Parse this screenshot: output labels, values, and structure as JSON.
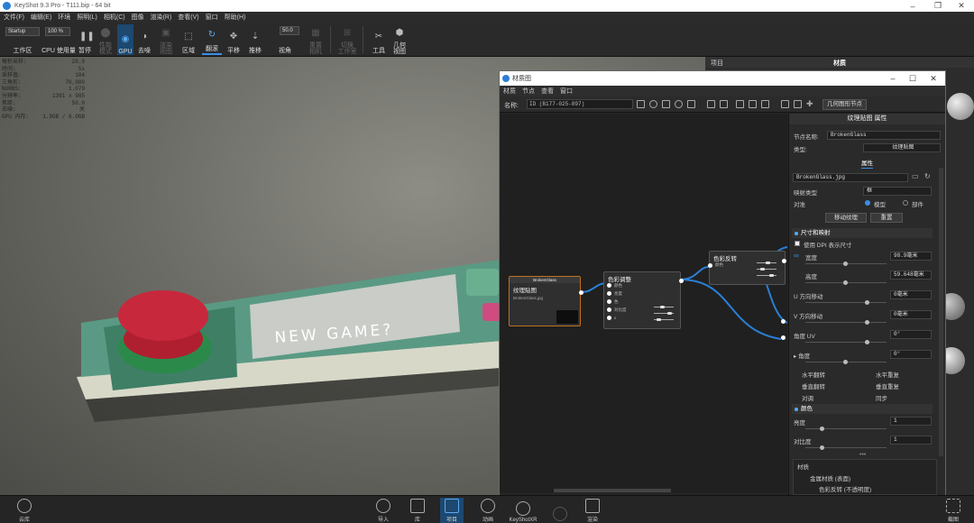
{
  "app": {
    "title": "KeyShot 9.3 Pro  -  T111.bip  -  64 bit"
  },
  "menubar": [
    "文件(F)",
    "编辑(E)",
    "环境",
    "照明(L)",
    "相机(C)",
    "图像",
    "渲染(R)",
    "查看(V)",
    "窗口",
    "帮助(H)"
  ],
  "toolbar": {
    "workspace_value": "Startup",
    "workspace_label": "工作区",
    "cpu_usage_value": "100 %",
    "cpu_usage_label": "CPU 使用量",
    "pause_label": "暂停",
    "perf_mode_label": "性能\n模式",
    "gpu_label": "GPU",
    "denoise_label": "去噪",
    "region_render_label": "渲染\n视图",
    "region_label": "区域",
    "tumble_label": "翻滚",
    "pan_label": "平移",
    "dolly_label": "推移",
    "fov_value": "50.0",
    "fov_label": "视角",
    "reset_camera_label": "重置\n相机",
    "switch_workspace_label": "切换\n工作室",
    "tools_label": "工具",
    "geometry_view_label": "几何\n视图"
  },
  "stats": [
    {
      "k": "每秒采样:",
      "v": "28.9"
    },
    {
      "k": "时间:",
      "v": "5s"
    },
    {
      "k": "采样值:",
      "v": "104"
    },
    {
      "k": "三角形:",
      "v": "70,080"
    },
    {
      "k": "NURBS:",
      "v": "1.079"
    },
    {
      "k": "分辨率:",
      "v": "1391 x 985"
    },
    {
      "k": "焦距:",
      "v": "50.0"
    },
    {
      "k": "去噪:",
      "v": "关"
    },
    {
      "k": "GPU 内存:",
      "v": "1.9GB / 6.0GB"
    }
  ],
  "scene": {
    "button_text": "NEW GAME?"
  },
  "right_panel": {
    "tab_project": "项目",
    "tab_materials": "材质"
  },
  "material_graph": {
    "title": "材质图",
    "menu": [
      "材质",
      "节点",
      "查看",
      "窗口"
    ],
    "name_label": "名称:",
    "name_value": "ID (B177-025-897)",
    "geometry_node_btn": "几何图形节点",
    "nodes": {
      "texture": {
        "header": "BrokenGlass",
        "title": "纹理贴图",
        "file": "BrokenGlass.jpg"
      },
      "color_adjust": {
        "title": "色彩调整",
        "ports": [
          "颜色",
          "亮度",
          "色",
          "对比度",
          "x"
        ]
      },
      "color_invert": {
        "title": "色彩反转",
        "port": "颜色"
      }
    },
    "props": {
      "header": "纹理贴图 属性",
      "node_name_label": "节点名称:",
      "node_name_value": "BrokenGlass",
      "type_label": "类型:",
      "type_value": "纹理贴图",
      "tab_props": "属性",
      "file_value": "BrokenGlass.jpg",
      "mapping_type_label": "映射类型",
      "mapping_type_value": "框",
      "align_label": "对准",
      "align_model": "模型",
      "align_part": "部件",
      "move_texture_btn": "移动纹理",
      "reset_btn": "重置",
      "section_size": "尺寸和映射",
      "use_dpi_label": "使用 DPI 表示尺寸",
      "width_label": "宽度",
      "width_value": "98.9毫米",
      "height_label": "高度",
      "height_value": "59.648毫米",
      "u_shift_label": "U 方向移动",
      "u_shift_value": "0毫米",
      "v_shift_label": "V 方向移动",
      "v_shift_value": "0毫米",
      "uv_angle_label": "角度 UV",
      "uv_angle_value": "0°",
      "angle_label": "▸ 角度",
      "angle_value": "0°",
      "flip_h": "水平翻转",
      "repeat_h": "水平重复",
      "flip_v": "垂直翻转",
      "repeat_v": "垂直重复",
      "swap": "对调",
      "sync": "同步",
      "section_color": "颜色",
      "brightness_label": "亮度",
      "brightness_value": "1",
      "contrast_label": "对比度",
      "contrast_value": "1",
      "tree": [
        "材质",
        "金属材质 (表面)",
        "色彩反转 (不透明度)"
      ]
    }
  },
  "bottombar": [
    {
      "label": "云库"
    },
    {
      "label": "导入"
    },
    {
      "label": "库"
    },
    {
      "label": "项目"
    },
    {
      "label": "动画"
    },
    {
      "label": "KeyShotXR"
    },
    {
      "label": "渲染"
    },
    {
      "label": "截图"
    }
  ],
  "colors": {
    "accent": "#3a8ee6",
    "device_body": "#5a9a84",
    "button_red": "#c8283c",
    "node_selected": "#c07020"
  }
}
